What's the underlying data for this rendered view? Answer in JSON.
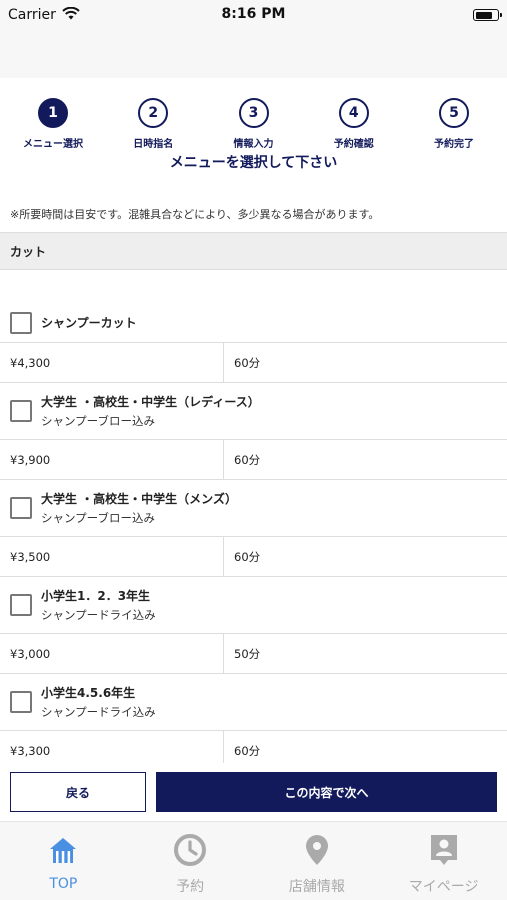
{
  "status_bar": {
    "carrier": "Carrier",
    "time": "8:16 PM"
  },
  "steps": [
    {
      "number": "1",
      "label": "メニュー選択",
      "active": true
    },
    {
      "number": "2",
      "label": "日時指名",
      "active": false
    },
    {
      "number": "3",
      "label": "情報入力",
      "active": false
    },
    {
      "number": "4",
      "label": "予約確認",
      "active": false
    },
    {
      "number": "5",
      "label": "予約完了",
      "active": false
    }
  ],
  "page_title": "メニューを選択して下さい",
  "notice": "※所要時間は目安です。混雑具合などにより、多少異なる場合があります。",
  "section": {
    "title": "カット"
  },
  "menus": [
    {
      "name": "シャンプーカット",
      "sub": "",
      "price": "¥4,300",
      "duration": "60分",
      "checked": false
    },
    {
      "name": "大学生 ・高校生・中学生（レディース）",
      "sub": "シャンプーブロー込み",
      "price": "¥3,900",
      "duration": "60分",
      "checked": false
    },
    {
      "name": "大学生 ・高校生・中学生（メンズ）",
      "sub": "シャンプーブロー込み",
      "price": "¥3,500",
      "duration": "60分",
      "checked": false
    },
    {
      "name": "小学生1．2．3年生",
      "sub": "シャンプードライ込み",
      "price": "¥3,000",
      "duration": "50分",
      "checked": false
    },
    {
      "name": "小学生4.5.6年生",
      "sub": "シャンプードライ込み",
      "price": "¥3,300",
      "duration": "60分",
      "checked": false
    }
  ],
  "actions": {
    "back_label": "戻る",
    "next_label": "この内容で次へ"
  },
  "tabs": [
    {
      "label": "TOP",
      "icon": "home-icon",
      "active": true
    },
    {
      "label": "予約",
      "icon": "clock-icon",
      "active": false
    },
    {
      "label": "店舗情報",
      "icon": "map-pin-icon",
      "active": false
    },
    {
      "label": "マイページ",
      "icon": "id-card-icon",
      "active": false
    }
  ],
  "colors": {
    "primary": "#121a5c",
    "tab_active": "#4a90e2",
    "tab_inactive": "#aaaaaa"
  }
}
